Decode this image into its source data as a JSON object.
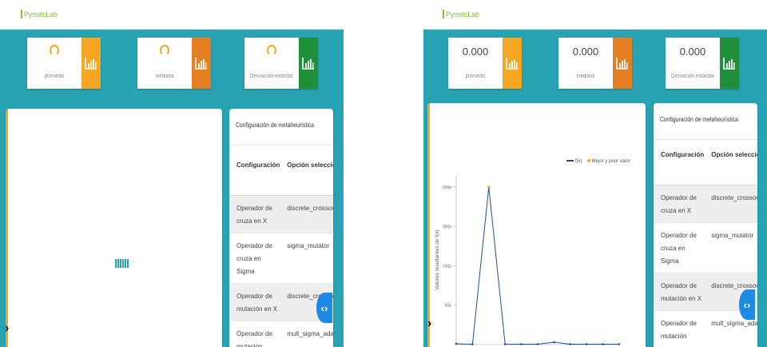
{
  "brand": "PyristicLab",
  "left": {
    "stats": [
      {
        "label": "promedio",
        "color": "#f6a623"
      },
      {
        "label": "mediana",
        "color": "#e67e22"
      },
      {
        "label": "Desviación estandar",
        "color": "#1f8f3a"
      }
    ],
    "config": {
      "title": "Configuración de metaheurística",
      "headers": [
        "Configuración",
        "Opción seleccionada"
      ],
      "rows": [
        {
          "config": "Operador de cruza en X",
          "option": "discrete_crossover"
        },
        {
          "config": "Operador de cruza en Sigma",
          "option": "sigma_mutator"
        },
        {
          "config": "Operador de mutación en X",
          "option": "discrete_crossover"
        },
        {
          "config": "Operador de mutación",
          "option": "mult_sigma_adaptive_mutator"
        }
      ]
    }
  },
  "right": {
    "stats": [
      {
        "value": "0.000",
        "label": "promedio",
        "color": "#f6a623"
      },
      {
        "value": "0.000",
        "label": "mediana",
        "color": "#e67e22"
      },
      {
        "value": "0.000",
        "label": "Desviación estandar",
        "color": "#1f8f3a"
      }
    ],
    "config": {
      "title": "Configuración de metaheurística",
      "headers": [
        "Configuración",
        "Opción seleccionada"
      ],
      "rows": [
        {
          "config": "Operador de cruza en X",
          "option": "discrete_crossover"
        },
        {
          "config": "Operador de cruza en Sigma",
          "option": "sigma_mutator"
        },
        {
          "config": "Operador de mutación en X",
          "option": "discrete_crossover"
        },
        {
          "config": "Operador de mutación",
          "option": "mult_sigma_adaptive_mutator"
        }
      ]
    }
  },
  "chart_data": {
    "type": "line",
    "ylabel": "Valores resultantes de f(x)",
    "yticks": [
      "50p",
      "100p",
      "150p",
      "200p"
    ],
    "ylim": [
      0,
      215
    ],
    "series": [
      {
        "name": "f(x)",
        "color": "#1f4e9a",
        "x": [
          0,
          1,
          2,
          3,
          4,
          5,
          6,
          7,
          8,
          9,
          10
        ],
        "values": [
          1,
          0.5,
          200,
          0.5,
          0.5,
          0.5,
          3,
          0.5,
          0.5,
          0.5,
          0.5
        ]
      },
      {
        "name": "Mejor y peor valor",
        "color": "#f6a623",
        "x": [
          2
        ],
        "values": [
          200
        ]
      }
    ],
    "legend": "top-right",
    "grid": false
  }
}
